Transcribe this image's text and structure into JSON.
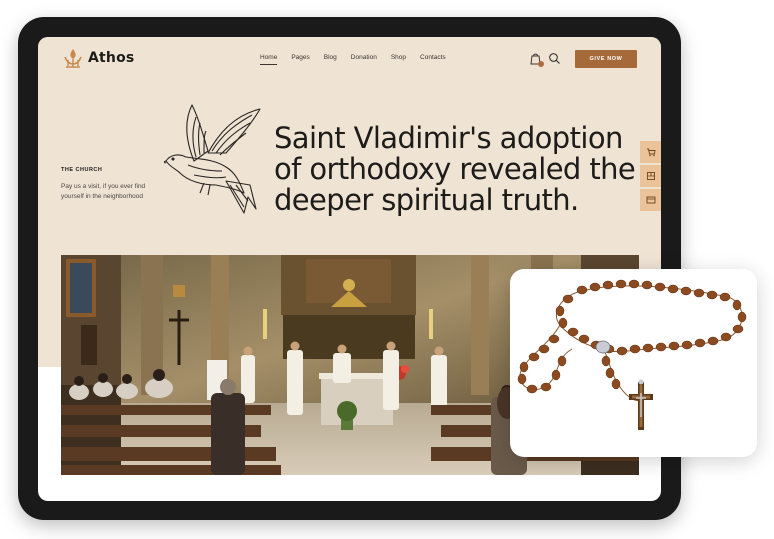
{
  "brand": {
    "name": "Athos"
  },
  "nav": {
    "items": [
      {
        "label": "Home",
        "active": true
      },
      {
        "label": "Pages"
      },
      {
        "label": "Blog"
      },
      {
        "label": "Donation"
      },
      {
        "label": "Shop"
      },
      {
        "label": "Contacts"
      }
    ]
  },
  "header": {
    "give_label": "GIVE NOW"
  },
  "sidebar_info": {
    "label": "THE CHURCH",
    "text": "Pay us a visit, if you ever find yourself in the neighborhood"
  },
  "hero": {
    "headline": "Saint Vladimir's adoption of orthodoxy revealed the deeper spiritual truth."
  },
  "icons": {
    "cart": "shopping-bag-icon",
    "search": "search-icon",
    "side_tabs": [
      "cart-icon",
      "book-icon",
      "layout-icon"
    ]
  },
  "colors": {
    "hero_bg": "#efe3d4",
    "accent": "#a66a3a",
    "side_tab": "#eac398",
    "text_dark": "#1d1c1a"
  }
}
